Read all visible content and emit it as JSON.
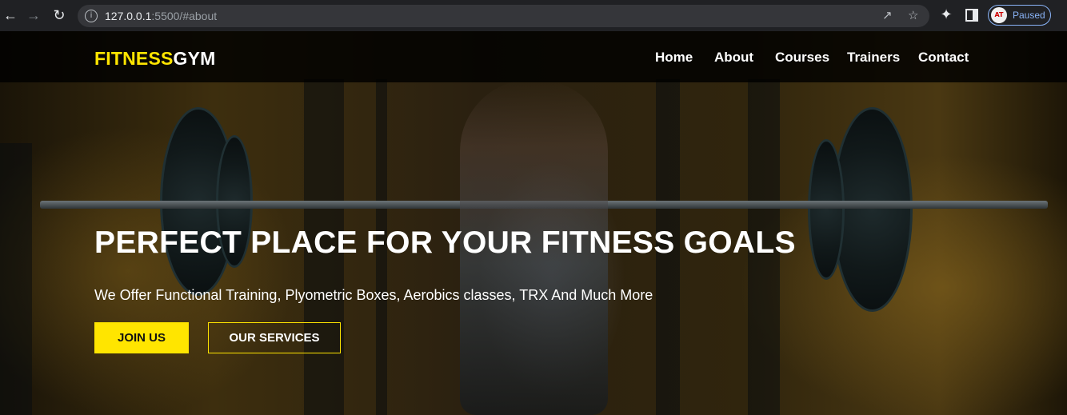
{
  "browser": {
    "url_host": "127.0.0.1",
    "url_path": ":5500/#about",
    "profile_status": "Paused",
    "profile_avatar": "AT"
  },
  "site": {
    "logo_part1": "FITNESS",
    "logo_part2": "GYM",
    "nav": [
      {
        "label": "Home"
      },
      {
        "label": "About"
      },
      {
        "label": "Courses"
      },
      {
        "label": "Trainers"
      },
      {
        "label": "Contact"
      }
    ],
    "hero": {
      "title": "PERFECT PLACE FOR YOUR FITNESS GOALS",
      "subtitle": "We Offer Functional Training, Plyometric Boxes, Aerobics classes, TRX And Much More",
      "primary_button": "JOIN US",
      "secondary_button": "OUR SERVICES"
    },
    "colors": {
      "accent": "#ffe500",
      "nav_bg": "#000000",
      "text": "#ffffff"
    }
  }
}
